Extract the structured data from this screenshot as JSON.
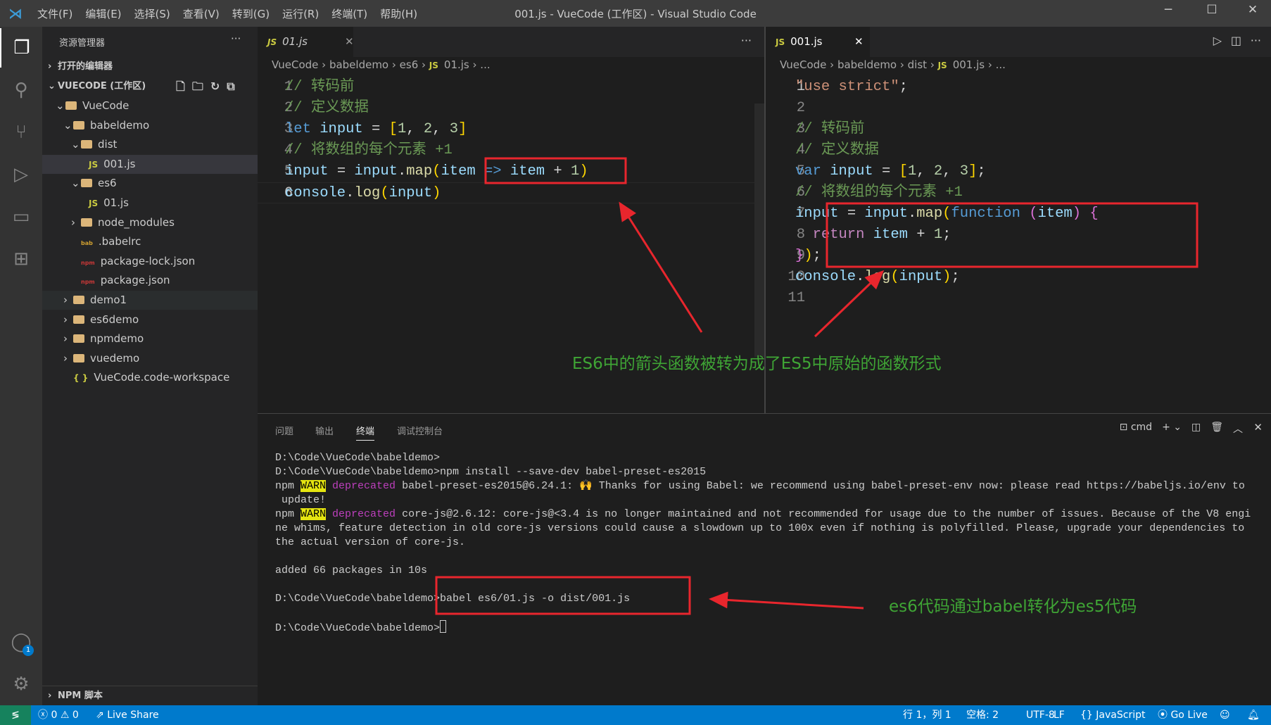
{
  "titlebar": {
    "menu": [
      "文件(F)",
      "编辑(E)",
      "选择(S)",
      "查看(V)",
      "转到(G)",
      "运行(R)",
      "终端(T)",
      "帮助(H)"
    ],
    "title": "001.js - VueCode (工作区) - Visual Studio Code",
    "minimize": "─",
    "maximize": "☐",
    "close": "✕"
  },
  "sidebar": {
    "title": "资源管理器",
    "more": "···",
    "open_editors": "打开的编辑器",
    "workspace": "VUECODE (工作区)",
    "tree": [
      {
        "label": "VueCode",
        "depth": 1,
        "chev": "⌄",
        "type": "folder"
      },
      {
        "label": "babeldemo",
        "depth": 2,
        "chev": "⌄",
        "type": "folder"
      },
      {
        "label": "dist",
        "depth": 3,
        "chev": "⌄",
        "type": "folder"
      },
      {
        "label": "001.js",
        "depth": 4,
        "chev": "",
        "type": "js",
        "selected": true
      },
      {
        "label": "es6",
        "depth": 3,
        "chev": "⌄",
        "type": "folder"
      },
      {
        "label": "01.js",
        "depth": 4,
        "chev": "",
        "type": "js"
      },
      {
        "label": "node_modules",
        "depth": 3,
        "chev": "›",
        "type": "folder"
      },
      {
        "label": ".babelrc",
        "depth": 3,
        "chev": "",
        "type": "babel"
      },
      {
        "label": "package-lock.json",
        "depth": 3,
        "chev": "",
        "type": "npm"
      },
      {
        "label": "package.json",
        "depth": 3,
        "chev": "",
        "type": "npm"
      },
      {
        "label": "demo1",
        "depth": 2,
        "chev": "›",
        "type": "folder",
        "hover": true
      },
      {
        "label": "es6demo",
        "depth": 2,
        "chev": "›",
        "type": "folder"
      },
      {
        "label": "npmdemo",
        "depth": 2,
        "chev": "›",
        "type": "folder"
      },
      {
        "label": "vuedemo",
        "depth": 2,
        "chev": "›",
        "type": "folder"
      },
      {
        "label": "VueCode.code-workspace",
        "depth": 2,
        "chev": "",
        "type": "workspace"
      }
    ],
    "npm_scripts": "NPM 脚本"
  },
  "editor_left": {
    "tab": "01.js",
    "tab_icon": "JS",
    "breadcrumb": [
      "VueCode",
      "babeldemo",
      "es6",
      "01.js",
      "..."
    ],
    "current_line": 6,
    "lines": [
      [
        [
          "// 转码前",
          "c"
        ]
      ],
      [
        [
          "// 定义数据",
          "c"
        ]
      ],
      [
        [
          "let ",
          "k"
        ],
        [
          "input",
          "v"
        ],
        [
          " = ",
          "w"
        ],
        [
          "[",
          "y"
        ],
        [
          "1",
          "n"
        ],
        [
          ", ",
          "w"
        ],
        [
          "2",
          "n"
        ],
        [
          ", ",
          "w"
        ],
        [
          "3",
          "n"
        ],
        [
          "]",
          "y"
        ]
      ],
      [
        [
          "// 将数组的每个元素 +1",
          "c"
        ]
      ],
      [
        [
          "input",
          "v"
        ],
        [
          " = ",
          "w"
        ],
        [
          "input",
          "v"
        ],
        [
          ".",
          "w"
        ],
        [
          "map",
          "f"
        ],
        [
          "(",
          "y"
        ],
        [
          "item",
          "v"
        ],
        [
          " => ",
          "k"
        ],
        [
          "item",
          "v"
        ],
        [
          " + ",
          "w"
        ],
        [
          "1",
          "n"
        ],
        [
          ")",
          "y"
        ]
      ],
      [
        [
          "console",
          "v"
        ],
        [
          ".",
          "w"
        ],
        [
          "log",
          "f"
        ],
        [
          "(",
          "y"
        ],
        [
          "input",
          "v"
        ],
        [
          ")",
          "y"
        ]
      ]
    ]
  },
  "editor_right": {
    "tab": "001.js",
    "tab_icon": "JS",
    "breadcrumb": [
      "VueCode",
      "babeldemo",
      "dist",
      "001.js",
      "..."
    ],
    "current_line": 1,
    "lines": [
      [
        [
          "\"use strict\"",
          "s"
        ],
        [
          ";",
          "w"
        ]
      ],
      [],
      [
        [
          "// 转码前",
          "c"
        ]
      ],
      [
        [
          "// 定义数据",
          "c"
        ]
      ],
      [
        [
          "var ",
          "k"
        ],
        [
          "input",
          "v"
        ],
        [
          " = ",
          "w"
        ],
        [
          "[",
          "y"
        ],
        [
          "1",
          "n"
        ],
        [
          ", ",
          "w"
        ],
        [
          "2",
          "n"
        ],
        [
          ", ",
          "w"
        ],
        [
          "3",
          "n"
        ],
        [
          "]",
          "y"
        ],
        [
          ";",
          "w"
        ]
      ],
      [
        [
          "// 将数组的每个元素 +1",
          "c"
        ]
      ],
      [
        [
          "input",
          "v"
        ],
        [
          " = ",
          "w"
        ],
        [
          "input",
          "v"
        ],
        [
          ".",
          "w"
        ],
        [
          "map",
          "f"
        ],
        [
          "(",
          "y"
        ],
        [
          "function ",
          "k"
        ],
        [
          "(",
          "p"
        ],
        [
          "item",
          "v"
        ],
        [
          ") ",
          "p"
        ],
        [
          "{",
          "p"
        ]
      ],
      [
        [
          "  return ",
          "kc"
        ],
        [
          "item",
          "v"
        ],
        [
          " + ",
          "w"
        ],
        [
          "1",
          "n"
        ],
        [
          ";",
          "w"
        ]
      ],
      [
        [
          "}",
          "p"
        ],
        [
          ")",
          "y"
        ],
        [
          ";",
          "w"
        ]
      ],
      [
        [
          "console",
          "v"
        ],
        [
          ".",
          "w"
        ],
        [
          "log",
          "f"
        ],
        [
          "(",
          "y"
        ],
        [
          "input",
          "v"
        ],
        [
          ")",
          "y"
        ],
        [
          ";",
          "w"
        ]
      ],
      []
    ]
  },
  "panel": {
    "tabs": [
      "问题",
      "输出",
      "终端",
      "调试控制台"
    ],
    "active_tab": "终端",
    "shell": "cmd",
    "terminal": [
      [
        [
          "D:\\Code\\VueCode\\babeldemo>",
          ""
        ]
      ],
      [
        [
          "D:\\Code\\VueCode\\babeldemo>npm install --save-dev babel-preset-es2015",
          ""
        ]
      ],
      [
        [
          "npm ",
          ""
        ],
        [
          "WARN",
          "warn"
        ],
        [
          " ",
          ""
        ],
        [
          "deprecated",
          "dep"
        ],
        [
          " babel-preset-es2015@6.24.1: 🙌 Thanks for using Babel: we recommend using babel-preset-env now: please read https://babeljs.io/env to",
          ""
        ]
      ],
      [
        [
          " update!",
          ""
        ]
      ],
      [
        [
          "npm ",
          ""
        ],
        [
          "WARN",
          "warn"
        ],
        [
          " ",
          ""
        ],
        [
          "deprecated",
          "dep"
        ],
        [
          " core-js@2.6.12: core-js@<3.4 is no longer maintained and not recommended for usage due to the number of issues. Because of the V8 engi",
          ""
        ]
      ],
      [
        [
          "ne whims, feature detection in old core-js versions could cause a slowdown up to 100x even if nothing is polyfilled. Please, upgrade your dependencies to",
          ""
        ]
      ],
      [
        [
          "the actual version of core-js.",
          ""
        ]
      ],
      [
        [
          "",
          ""
        ]
      ],
      [
        [
          "added 66 packages in 10s",
          ""
        ]
      ],
      [
        [
          "",
          ""
        ]
      ],
      [
        [
          "D:\\Code\\VueCode\\babeldemo>babel es6/01.js -o dist/001.js",
          ""
        ]
      ],
      [
        [
          "",
          ""
        ]
      ],
      [
        [
          "D:\\Code\\VueCode\\babeldemo>",
          ""
        ]
      ]
    ]
  },
  "status": {
    "errors": "0",
    "warnings": "0",
    "live_share": "Live Share",
    "position": "行 1，列 1",
    "spaces": "空格: 2",
    "encoding": "UTF-8",
    "eol": "LF",
    "language": "JavaScript",
    "go_live": "Go Live",
    "accounts_badge": "1"
  },
  "annotations": {
    "top": "ES6中的箭头函数被转为成了ES5中原始的函数形式",
    "bottom": "es6代码通过babel转化为es5代码",
    "color": "#3fa535",
    "box_color": "#e8262d"
  }
}
